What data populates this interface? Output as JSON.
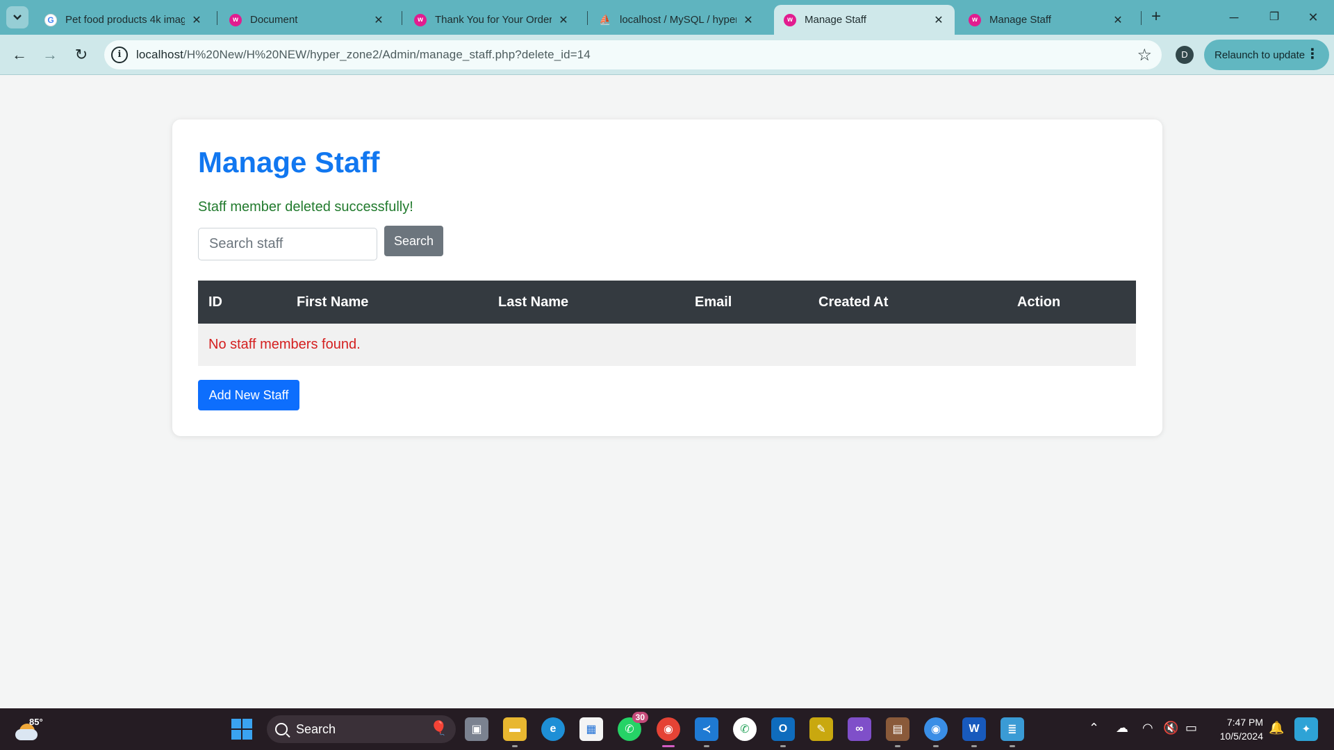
{
  "browser": {
    "tabs": [
      {
        "title": "Pet food products 4k imag",
        "favicon": "google-icon",
        "active": false
      },
      {
        "title": "Document",
        "favicon": "wamp-icon",
        "active": false
      },
      {
        "title": "Thank You for Your Order",
        "favicon": "wamp-icon",
        "active": false
      },
      {
        "title": "localhost / MySQL / hyper_",
        "favicon": "phpmyadmin-icon",
        "active": false
      },
      {
        "title": "Manage Staff",
        "favicon": "wamp-icon",
        "active": true
      },
      {
        "title": "Manage Staff",
        "favicon": "wamp-icon",
        "active": false
      }
    ],
    "url_host": "localhost",
    "url_path": "/H%20New/H%20NEW/hyper_zone2/Admin/manage_staff.php?delete_id=14",
    "profile_initial": "D",
    "relaunch_label": "Relaunch to update"
  },
  "page": {
    "title": "Manage Staff",
    "flash_message": "Staff member deleted successfully!",
    "search": {
      "placeholder": "Search staff",
      "value": "",
      "button_label": "Search"
    },
    "table": {
      "columns": [
        "ID",
        "First Name",
        "Last Name",
        "Email",
        "Created At",
        "Action"
      ],
      "empty_message": "No staff members found."
    },
    "add_button_label": "Add New Staff",
    "colors": {
      "title": "#1177f0",
      "success": "#217a2d",
      "error": "#d41f1f",
      "primary": "#0d6efd",
      "secondary": "#6c757d",
      "table_header": "#343a40"
    }
  },
  "taskbar": {
    "weather_temp": "85°",
    "search_label": "Search",
    "whatsapp_badge": "30",
    "time": "7:47 PM",
    "date": "10/5/2024"
  }
}
